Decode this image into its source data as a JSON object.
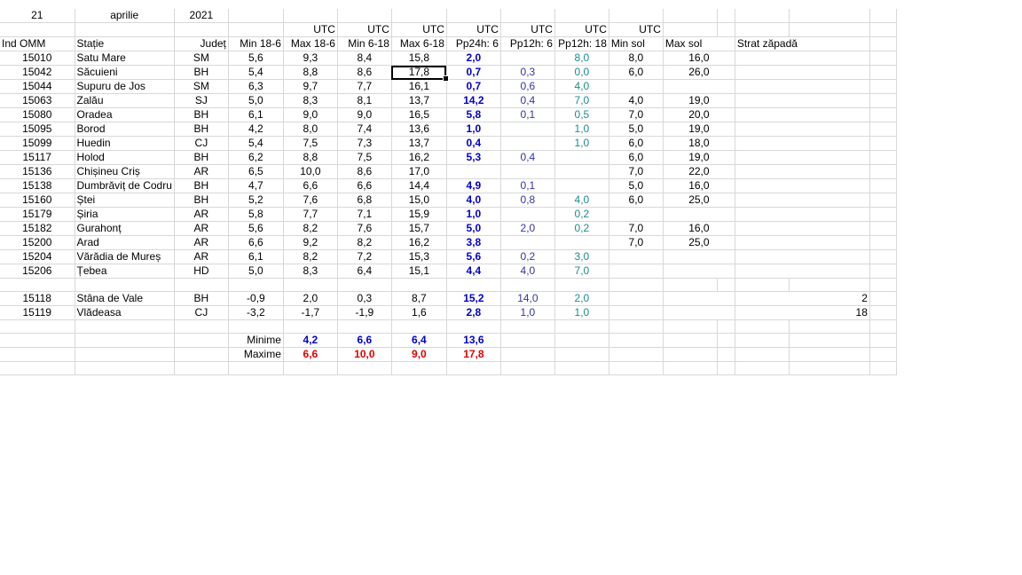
{
  "date": {
    "day": "21",
    "month": "aprilie",
    "year": "2021"
  },
  "utc_label": "UTC",
  "headers": [
    "Ind OMM",
    "Stație",
    "Județ",
    "Min 18-6",
    "Max 18-6",
    "Min 6-18",
    "Max 6-18",
    "Pp24h: 6",
    "Pp12h: 6",
    "Pp12h: 18",
    "Min sol",
    "Max sol",
    "Strat zăpadă"
  ],
  "rows": [
    [
      "15010",
      "Satu Mare",
      "SM",
      "5,6",
      "9,3",
      "8,4",
      "15,8",
      "2,0",
      "",
      "8,0",
      "8,0",
      "16,0",
      ""
    ],
    [
      "15042",
      "Săcuieni",
      "BH",
      "5,4",
      "8,8",
      "8,6",
      "17,8",
      "0,7",
      "0,3",
      "0,0",
      "6,0",
      "26,0",
      ""
    ],
    [
      "15044",
      "Supuru de Jos",
      "SM",
      "6,3",
      "9,7",
      "7,7",
      "16,1",
      "0,7",
      "0,6",
      "4,0",
      "",
      "",
      ""
    ],
    [
      "15063",
      "Zalău",
      "SJ",
      "5,0",
      "8,3",
      "8,1",
      "13,7",
      "14,2",
      "0,4",
      "7,0",
      "4,0",
      "19,0",
      ""
    ],
    [
      "15080",
      "Oradea",
      "BH",
      "6,1",
      "9,0",
      "9,0",
      "16,5",
      "5,8",
      "0,1",
      "0,5",
      "7,0",
      "20,0",
      ""
    ],
    [
      "15095",
      "Borod",
      "BH",
      "4,2",
      "8,0",
      "7,4",
      "13,6",
      "1,0",
      "",
      "1,0",
      "5,0",
      "19,0",
      ""
    ],
    [
      "15099",
      "Huedin",
      "CJ",
      "5,4",
      "7,5",
      "7,3",
      "13,7",
      "0,4",
      "",
      "1,0",
      "6,0",
      "18,0",
      ""
    ],
    [
      "15117",
      "Holod",
      "BH",
      "6,2",
      "8,8",
      "7,5",
      "16,2",
      "5,3",
      "0,4",
      "",
      "6,0",
      "19,0",
      ""
    ],
    [
      "15136",
      "Chișineu   Criș",
      "AR",
      "6,5",
      "10,0",
      "8,6",
      "17,0",
      "",
      "",
      "",
      "7,0",
      "22,0",
      ""
    ],
    [
      "15138",
      "Dumbrăviț  de Codru",
      "BH",
      "4,7",
      "6,6",
      "6,6",
      "14,4",
      "4,9",
      "0,1",
      "",
      "5,0",
      "16,0",
      ""
    ],
    [
      "15160",
      "Ștei",
      "BH",
      "5,2",
      "7,6",
      "6,8",
      "15,0",
      "4,0",
      "0,8",
      "4,0",
      "6,0",
      "25,0",
      ""
    ],
    [
      "15179",
      "Șiria",
      "AR",
      "5,8",
      "7,7",
      "7,1",
      "15,9",
      "1,0",
      "",
      "0,2",
      "",
      "",
      ""
    ],
    [
      "15182",
      "Gurahonț",
      "AR",
      "5,6",
      "8,2",
      "7,6",
      "15,7",
      "5,0",
      "2,0",
      "0,2",
      "7,0",
      "16,0",
      ""
    ],
    [
      "15200",
      "Arad",
      "AR",
      "6,6",
      "9,2",
      "8,2",
      "16,2",
      "3,8",
      "",
      "",
      "7,0",
      "25,0",
      ""
    ],
    [
      "15204",
      "Vărădia de Mureș",
      "AR",
      "6,1",
      "8,2",
      "7,2",
      "15,3",
      "5,6",
      "0,2",
      "3,0",
      "",
      "",
      ""
    ],
    [
      "15206",
      "Țebea",
      "HD",
      "5,0",
      "8,3",
      "6,4",
      "15,1",
      "4,4",
      "4,0",
      "7,0",
      "",
      "",
      ""
    ]
  ],
  "mountain_rows": [
    [
      "15118",
      "Stâna de Vale",
      "BH",
      "-0,9",
      "2,0",
      "0,3",
      "8,7",
      "15,2",
      "14,0",
      "2,0",
      "",
      "",
      "2"
    ],
    [
      "15119",
      "Vlădeasa",
      "CJ",
      "-3,2",
      "-1,7",
      "-1,9",
      "1,6",
      "2,8",
      "1,0",
      "1,0",
      "",
      "",
      "18"
    ]
  ],
  "summary": {
    "min_label": "Minime",
    "max_label": "Maxime",
    "minimums": [
      "4,2",
      "6,6",
      "6,4",
      "13,6"
    ],
    "maximums": [
      "6,6",
      "10,0",
      "9,0",
      "17,8"
    ]
  },
  "colors": {
    "blue": "#0000cc",
    "purple": "#3333aa",
    "teal": "#1a8c8c",
    "red": "#e00000",
    "grid": "#d8d8d8"
  }
}
